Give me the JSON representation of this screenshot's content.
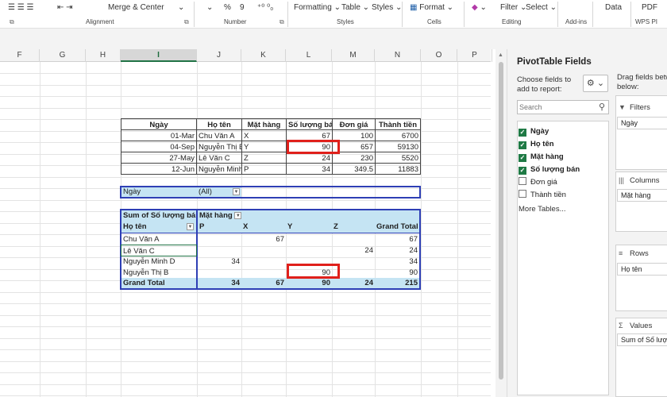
{
  "ribbon": {
    "alignment": {
      "merge_center": "Merge & Center",
      "group": "Alignment"
    },
    "number": {
      "group": "Number",
      "percent": "%",
      "comma": "9"
    },
    "styles": {
      "formatting": "Formatting",
      "table": "Table",
      "styles": "Styles",
      "group": "Styles"
    },
    "cells": {
      "format": "Format",
      "group": "Cells"
    },
    "editing": {
      "filter_select": "Filter",
      "select": "Select",
      "group": "Editing"
    },
    "addins": {
      "group": "Add-ins"
    },
    "data": {
      "label": "Data"
    },
    "pdf": {
      "label": "PDF",
      "group": "WPS PI"
    }
  },
  "columns": [
    {
      "name": "F"
    },
    {
      "name": "G"
    },
    {
      "name": "H"
    },
    {
      "name": "I"
    },
    {
      "name": "J"
    },
    {
      "name": "K"
    },
    {
      "name": "L"
    },
    {
      "name": "M"
    },
    {
      "name": "N"
    },
    {
      "name": "O"
    },
    {
      "name": "P"
    }
  ],
  "source_table": {
    "headers": [
      "Ngày",
      "Họ tên",
      "Mặt hàng",
      "Số lượng bán",
      "Đơn giá",
      "Thành tiền"
    ],
    "rows": [
      [
        "01-Mar",
        "Chu Văn A",
        "X",
        "67",
        "100",
        "6700"
      ],
      [
        "04-Sep",
        "Nguyễn Thị B",
        "Y",
        "90",
        "657",
        "59130"
      ],
      [
        "27-May",
        "Lê Văn C",
        "Z",
        "24",
        "230",
        "5520"
      ],
      [
        "12-Jun",
        "Nguyễn Minh D",
        "P",
        "34",
        "349.5",
        "11883"
      ]
    ]
  },
  "pivot": {
    "filter_label": "Ngày",
    "filter_value": "(All)",
    "value_header": "Sum of Số lượng bán",
    "column_header": "Mặt hàng",
    "row_header": "Họ tên",
    "col_labels": [
      "P",
      "X",
      "Y",
      "Z",
      "Grand Total"
    ],
    "rows": [
      {
        "name": "Chu Văn A",
        "P": "",
        "X": "67",
        "Y": "",
        "Z": "",
        "total": "67"
      },
      {
        "name": "Lê Văn C",
        "P": "",
        "X": "",
        "Y": "",
        "Z": "24",
        "total": "24"
      },
      {
        "name": "Nguyễn Minh D",
        "P": "34",
        "X": "",
        "Y": "",
        "Z": "",
        "total": "34"
      },
      {
        "name": "Nguyễn Thị B",
        "P": "",
        "X": "",
        "Y": "90",
        "Z": "",
        "total": "90"
      }
    ],
    "grand": {
      "name": "Grand Total",
      "P": "34",
      "X": "67",
      "Y": "90",
      "Z": "24",
      "total": "215"
    }
  },
  "panel": {
    "title": "PivotTable Fields",
    "choose_text_1": "Choose fields to",
    "choose_text_2": "add to report:",
    "search_placeholder": "Search",
    "drag_text_1": "Drag fields betw",
    "drag_text_2": "below:",
    "fields": [
      {
        "label": "Ngày",
        "checked": true
      },
      {
        "label": "Họ tên",
        "checked": true
      },
      {
        "label": "Mặt hàng",
        "checked": true
      },
      {
        "label": "Số lượng bán",
        "checked": true
      },
      {
        "label": "Đơn giá",
        "checked": false
      },
      {
        "label": "Thành tiền",
        "checked": false
      }
    ],
    "more_tables": "More Tables...",
    "areas": {
      "filters": {
        "label": "Filters",
        "item": "Ngày"
      },
      "columns": {
        "label": "Columns",
        "item": "Mặt hàng"
      },
      "rows": {
        "label": "Rows",
        "item": "Họ tên"
      },
      "values": {
        "label": "Values",
        "item": "Sum of Số lượng"
      }
    }
  },
  "colors": {
    "accent": "#217346",
    "pivot_fill": "#c5e4f3",
    "highlight": "#e0201b",
    "pivot_border": "#2e3fb5"
  }
}
